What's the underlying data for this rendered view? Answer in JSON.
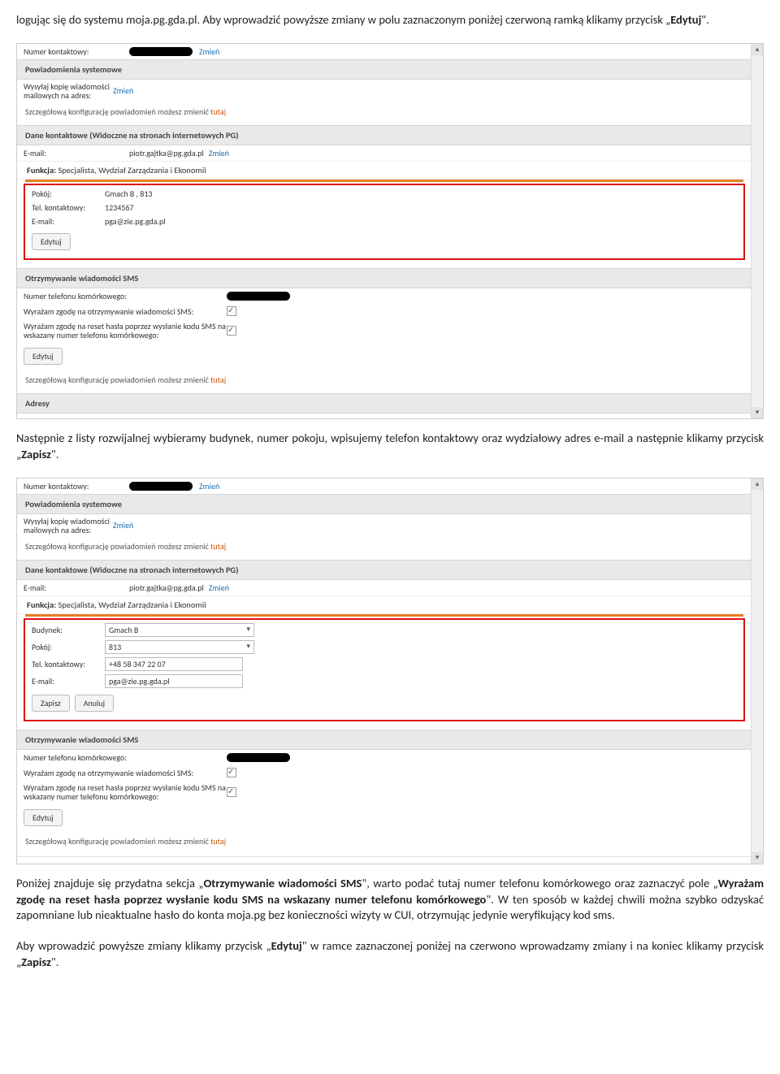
{
  "doc": {
    "p1a": "logując się do systemu moja.pg.gda.pl. Aby wprowadzić powyższe zmiany w polu zaznaczonym poniżej czerwoną ramką klikamy przycisk „",
    "p1b": "Edytuj",
    "p1c": "\".",
    "p2a": "Następnie z listy rozwijalnej wybieramy budynek, numer pokoju, wpisujemy telefon kontaktowy oraz wydziałowy adres e-mail a następnie klikamy przycisk „",
    "p2b": "Zapisz",
    "p2c": "\".",
    "p3a": "Poniżej znajduje się przydatna sekcja „",
    "p3b": "Otrzymywanie wiadomości SMS",
    "p3c": "\", warto podać tutaj numer telefonu komórkowego oraz zaznaczyć pole „",
    "p3d": "Wyrażam zgodę na reset hasła poprzez wysłanie kodu SMS na wskazany numer telefonu komórkowego",
    "p3e": "\". W ten sposób w każdej chwili można szybko odzyskać zapomniane lub nieaktualne hasło do konta moja.pg bez konieczności wizyty w CUI, otrzymując jedynie weryfikujący kod sms.",
    "p4a": "Aby wprowadzić powyższe zmiany klikamy przycisk „",
    "p4b": "Edytuj",
    "p4c": "\" w ramce zaznaczonej poniżej na czerwono wprowadzamy zmiany i na koniec klikamy przycisk „",
    "p4d": "Zapisz",
    "p4e": "\"."
  },
  "labels": {
    "numer_kontaktowy": "Numer kontaktowy:",
    "zmien": "Zmień",
    "powiadomienia_systemowe": "Powiadomienia systemowe",
    "wysylaj_kopie": "Wysyłaj kopię wiadomości mailowych na adres:",
    "szczegolowa_konf": "Szczegółową konfigurację powiadomień możesz zmienić ",
    "tutaj": "tutaj",
    "dane_kontaktowe": "Dane kontaktowe (Widoczne na stronach internetowych PG)",
    "email": "E-mail:",
    "email_val": "piotr.gajtka@pg.gda.pl",
    "funkcja_lbl": "Funkcja:",
    "funkcja_val": "Specjalista, Wydział Zarządzania i Ekonomii",
    "pokoj": "Pokój:",
    "tel_kont": "Tel. kontaktowy:",
    "pokoj_val": "Gmach B , 813",
    "tel_val": "1234567",
    "email2_val": "pga@zie.pg.gda.pl",
    "edytuj": "Edytuj",
    "otrzymywanie_sms": "Otrzymywanie wiadomości SMS",
    "numer_tel_kom": "Numer telefonu komórkowego:",
    "zgoda_sms": "Wyrażam zgodę na otrzymywanie wiadomości SMS:",
    "zgoda_reset": "Wyrażam zgodę na reset hasła poprzez wysłanie kodu SMS na wskazany numer telefonu komórkowego:",
    "adresy": "Adresy",
    "budynek": "Budynek:",
    "budynek_val": "Gmach B",
    "pokoj2_val": "813",
    "tel2_val": "+48 58 347 22 07",
    "zapisz": "Zapisz",
    "anuluj": "Anuluj"
  }
}
